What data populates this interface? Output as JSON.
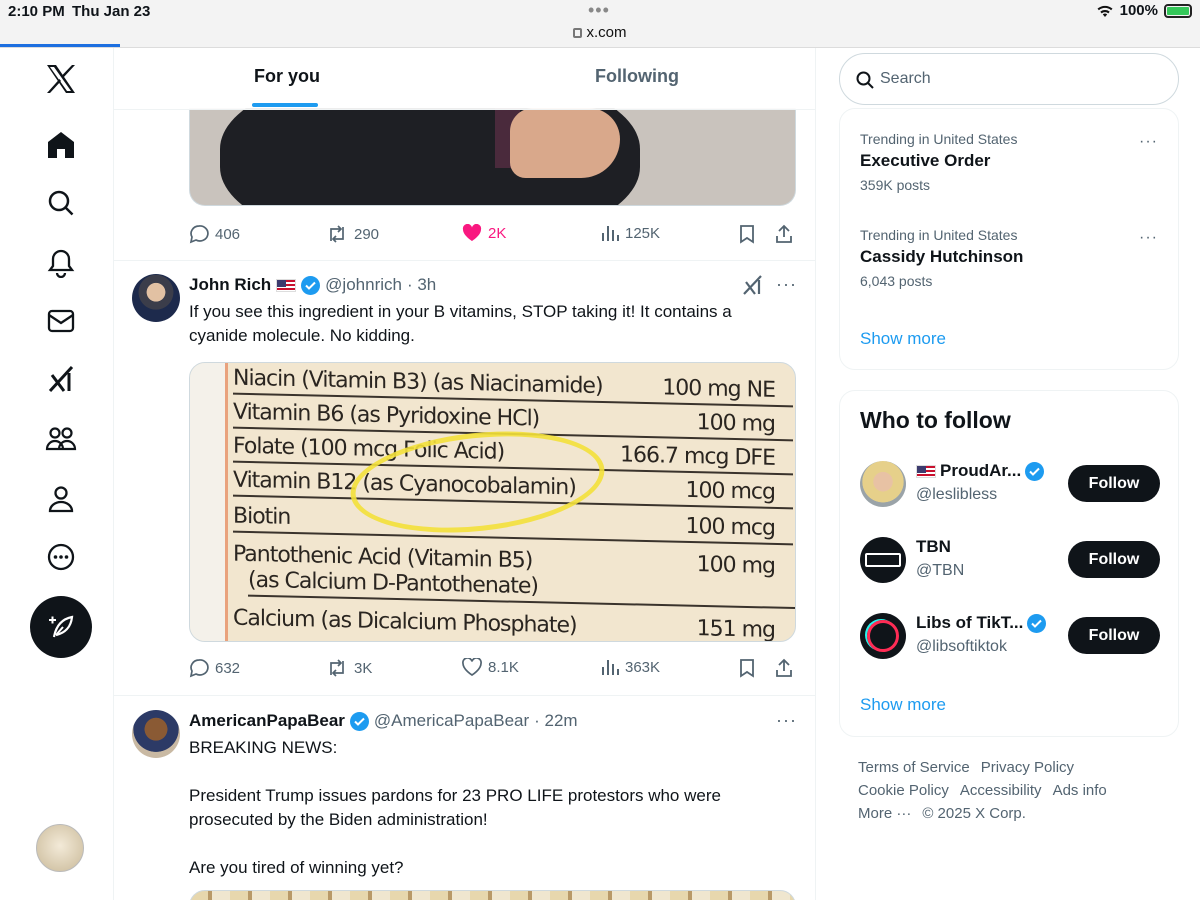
{
  "status_bar": {
    "time": "2:10 PM",
    "date": "Thu Jan 23",
    "url": "x.com",
    "battery": "100%"
  },
  "nav": {
    "items": [
      "x-logo-icon",
      "home-icon",
      "search-icon",
      "notifications-icon",
      "messages-icon",
      "grok-icon",
      "communities-icon",
      "profile-icon",
      "more-icon"
    ],
    "compose_icon": "compose-feather-icon"
  },
  "tabs": {
    "for_you": "For you",
    "following": "Following"
  },
  "tweets": [
    {
      "actions": {
        "replies": "406",
        "reposts": "290",
        "likes": "2K",
        "views": "125K"
      },
      "liked": true
    },
    {
      "name": "John Rich",
      "handle": "@johnrich",
      "time": "· 3h",
      "text": "If you see this ingredient in your B vitamins, STOP taking it! It contains a cyanide molecule. No kidding.",
      "image_label": [
        {
          "name": "Niacin (Vitamin B3) (as Niacinamide)",
          "amount": "100 mg NE"
        },
        {
          "name": "Vitamin B6 (as Pyridoxine HCl)",
          "amount": "100 mg"
        },
        {
          "name": "Folate (100 mcg Folic Acid)",
          "amount": "166.7 mcg DFE"
        },
        {
          "name": "Vitamin B12 (as Cyanocobalamin)",
          "amount": "100 mcg"
        },
        {
          "name": "Biotin",
          "amount": "100 mcg"
        },
        {
          "name": "Pantothenic Acid (Vitamin B5)",
          "amount": "100 mg"
        },
        {
          "name": "(as Calcium D-Pantothenate)",
          "amount": ""
        },
        {
          "name": "Calcium (as Dicalcium Phosphate)",
          "amount": "151 mg"
        }
      ],
      "actions": {
        "replies": "632",
        "reposts": "3K",
        "likes": "8.1K",
        "views": "363K"
      }
    },
    {
      "name": "AmericanPapaBear",
      "handle": "@AmericaPapaBear",
      "time": "· 22m",
      "text": "BREAKING NEWS:\n\nPresident Trump issues pardons for 23 PRO LIFE protestors who were prosecuted by the Biden administration!\n\nAre you tired of winning yet?"
    }
  ],
  "search": {
    "placeholder": "Search"
  },
  "trends": [
    {
      "context": "Trending in United States",
      "title": "Executive Order",
      "count": "359K posts"
    },
    {
      "context": "Trending in United States",
      "title": "Cassidy Hutchinson",
      "count": "6,043 posts"
    }
  ],
  "trends_show_more": "Show more",
  "who_to_follow": {
    "title": "Who to follow",
    "accounts": [
      {
        "name": "ProudAr...",
        "handle": "@leslibless",
        "button": "Follow"
      },
      {
        "name": "TBN",
        "handle": "@TBN",
        "button": "Follow"
      },
      {
        "name": "Libs of TikT...",
        "handle": "@libsoftiktok",
        "button": "Follow"
      }
    ],
    "show_more": "Show more"
  },
  "footer": {
    "links": [
      "Terms of Service",
      "Privacy Policy",
      "Cookie Policy",
      "Accessibility",
      "Ads info",
      "More ···"
    ],
    "copyright": "© 2025 X Corp."
  },
  "colors": {
    "accent": "#1d9bf0",
    "like": "#f91880",
    "highlight": "#f3e03a"
  }
}
